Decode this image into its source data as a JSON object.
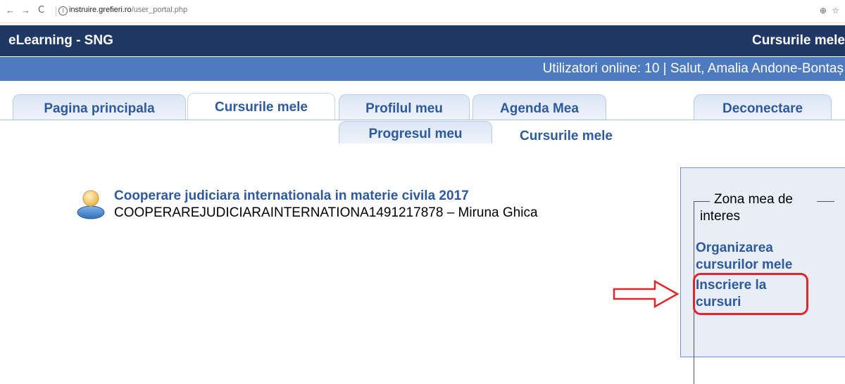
{
  "browser": {
    "back": "←",
    "forward": "→",
    "reload": "C",
    "info": "i",
    "url_host": "instruire.grefieri.ro",
    "url_path": "/user_portal.php",
    "zoom_icon": "⊕",
    "star_icon": "☆"
  },
  "header": {
    "site_title": "eLearning - SNG",
    "page_title": "Cursurile mele",
    "userbar_text": "Utilizatori online:  10   | Salut, Amalia Andone-Bontaș"
  },
  "tabs": [
    {
      "label": "Pagina principala"
    },
    {
      "label": "Cursurile mele"
    },
    {
      "label": "Profilul meu"
    },
    {
      "label": "Agenda Mea"
    },
    {
      "label": "Deconectare"
    }
  ],
  "subtabs": [
    {
      "label": "Progresul meu"
    },
    {
      "label": "Cursurile mele"
    }
  ],
  "course": {
    "title": "Cooperare judiciara internationala in materie civila 2017",
    "code_line": "COOPERAREJUDICIARAINTERNATIONA1491217878 – Miruna Ghica"
  },
  "side": {
    "legend_line1": "Zona mea de",
    "legend_line2": "interes",
    "link1_line1": "Organizarea",
    "link1_line2": "cursurilor mele",
    "link2_line1": "Inscriere la",
    "link2_line2": "cursuri"
  },
  "colors": {
    "header": "#1f3864",
    "userbar": "#4e7bbf",
    "link": "#2e5a9c",
    "annotation": "#e1252b"
  }
}
